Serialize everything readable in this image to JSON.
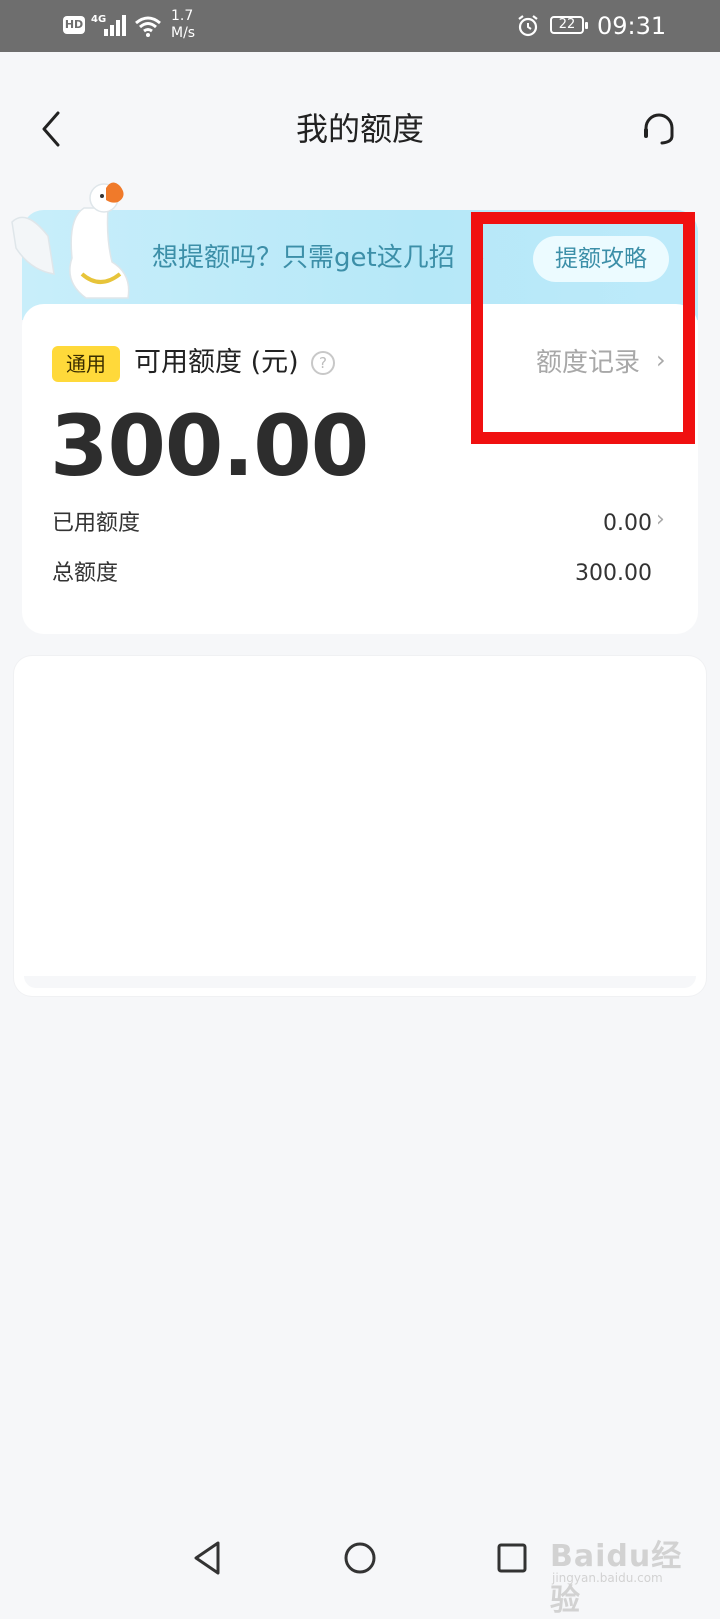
{
  "status_bar": {
    "hd": "HD",
    "network": "4G",
    "speed_value": "1.7",
    "speed_unit": "M/s",
    "battery": "22",
    "time": "09:31"
  },
  "header": {
    "title": "我的额度",
    "back_icon": "chevron-left-icon",
    "service_icon": "headset-icon"
  },
  "banner": {
    "text": "想提额吗？只需get这几招",
    "button_label": "提额攻略",
    "mascot": "goose-mascot"
  },
  "credit_card": {
    "tag": "通用",
    "available_label": "可用额度 (元)",
    "help_symbol": "?",
    "record_link": "额度记录",
    "available_amount": "300.00",
    "used_label": "已用额度",
    "used_value": "0.00",
    "total_label": "总额度",
    "total_value": "300.00"
  },
  "colors": {
    "accent_tag": "#ffd93a",
    "banner_text": "#3c8fa8",
    "highlight": "#f01010"
  },
  "system_nav": {
    "back_icon": "triangle-back-icon",
    "home_icon": "circle-home-icon",
    "recent_icon": "square-recent-icon"
  },
  "watermark": {
    "brand": "Baidu经验",
    "url": "jingyan.baidu.com"
  }
}
